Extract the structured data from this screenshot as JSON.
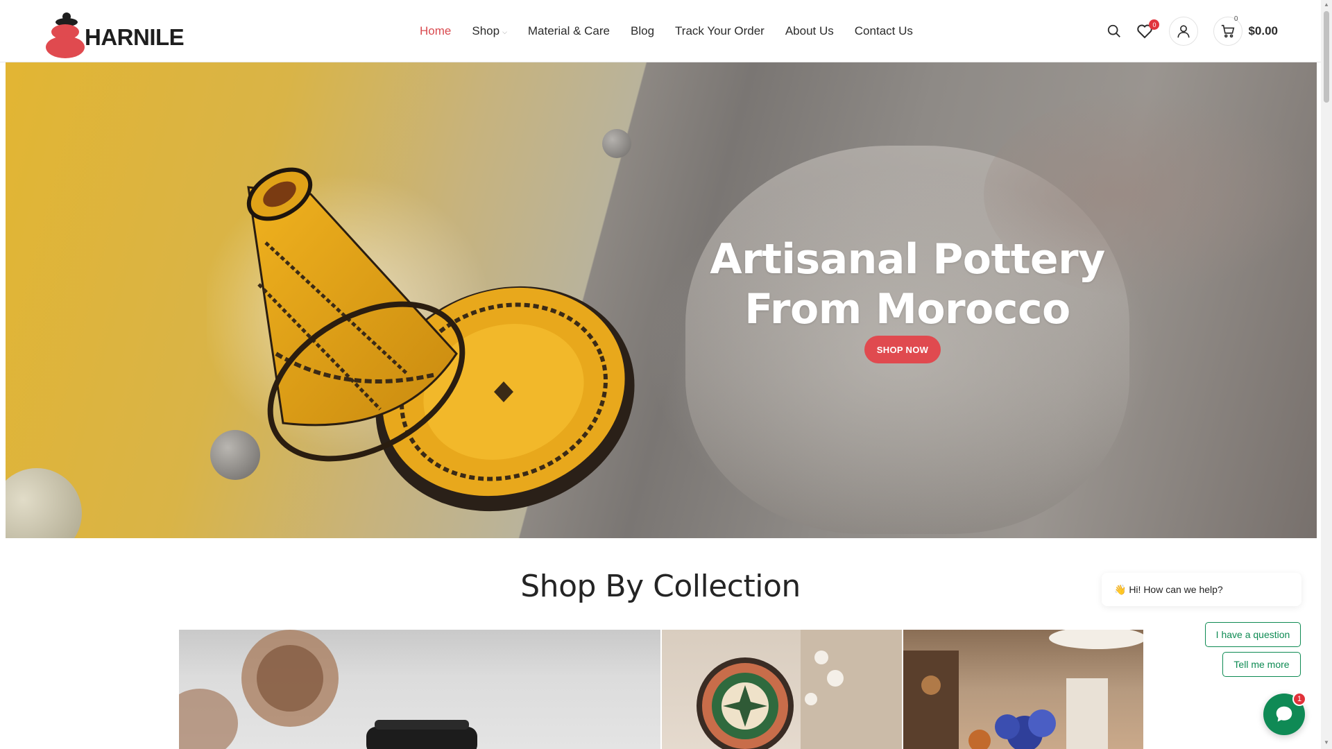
{
  "brand": {
    "name": "HARNILE",
    "accent": "#e04a4f"
  },
  "nav": {
    "items": [
      {
        "label": "Home",
        "active": true
      },
      {
        "label": "Shop",
        "has_dropdown": true
      },
      {
        "label": "Material & Care"
      },
      {
        "label": "Blog"
      },
      {
        "label": "Track Your Order"
      },
      {
        "label": "About Us"
      },
      {
        "label": "Contact Us"
      }
    ]
  },
  "header": {
    "icons": [
      "search-icon",
      "heart-icon",
      "user-icon",
      "cart-icon"
    ],
    "wishlist_count": "0",
    "cart_count": "0",
    "cart_total": "$0.00"
  },
  "hero": {
    "title_line1": "Artisanal Pottery",
    "title_line2": "From Morocco",
    "cta_label": "SHOP NOW"
  },
  "collections": {
    "title": "Shop By Collection"
  },
  "chat": {
    "greeting": "👋 Hi! How can we help?",
    "options": [
      "I have a question",
      "Tell me more"
    ],
    "unread": "1",
    "brand_color": "#0f8a55"
  }
}
